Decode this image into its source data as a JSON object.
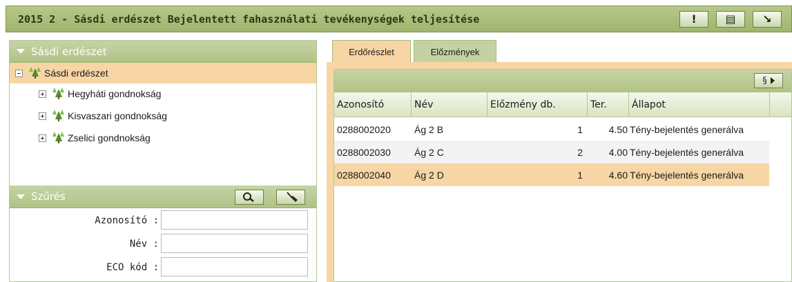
{
  "window": {
    "title": "2015 2 - Sásdi erdészet Bejelentett fahasználati tevékenységek teljesítése",
    "buttons": [
      {
        "icon": "exclamation-icon",
        "glyph": "!"
      },
      {
        "icon": "document-icon",
        "glyph": "▤"
      },
      {
        "icon": "arrow-down-right-icon",
        "glyph": "↘"
      }
    ]
  },
  "left": {
    "tree_header": "Sásdi erdészet",
    "tree": [
      {
        "label": "Sásdi erdészet",
        "expanded": true,
        "level": 0
      },
      {
        "label": "Hegyháti gondnokság",
        "expanded": false,
        "level": 1
      },
      {
        "label": "Kisvaszari gondnokság",
        "expanded": false,
        "level": 1
      },
      {
        "label": "Zselici gondnokság",
        "expanded": false,
        "level": 1
      }
    ],
    "filter_header": "Szűrés",
    "filter_fields": [
      {
        "label": "Azonosító :",
        "value": ""
      },
      {
        "label": "Név :",
        "value": ""
      },
      {
        "label": "ECO kód :",
        "value": ""
      }
    ]
  },
  "right": {
    "tabs": [
      {
        "label": "Erdőrészlet",
        "active": true
      },
      {
        "label": "Előzmények",
        "active": false
      }
    ],
    "section_button": "§",
    "columns": [
      "Azonosító",
      "Név",
      "Előzmény db.",
      "Ter.",
      "Állapot"
    ],
    "rows": [
      {
        "id": "0288002020",
        "name": "Ág 2 B",
        "prev": "1",
        "area": "4.50",
        "status": "Tény-bejelentés generálva"
      },
      {
        "id": "0288002030",
        "name": "Ág 2 C",
        "prev": "2",
        "area": "4.00",
        "status": "Tény-bejelentés generálva"
      },
      {
        "id": "0288002040",
        "name": "Ág 2 D",
        "prev": "1",
        "area": "4.60",
        "status": "Tény-bejelentés generálva"
      }
    ]
  },
  "colors": {
    "header_green": "#b0c285",
    "selected_orange": "#f8d5a5"
  }
}
